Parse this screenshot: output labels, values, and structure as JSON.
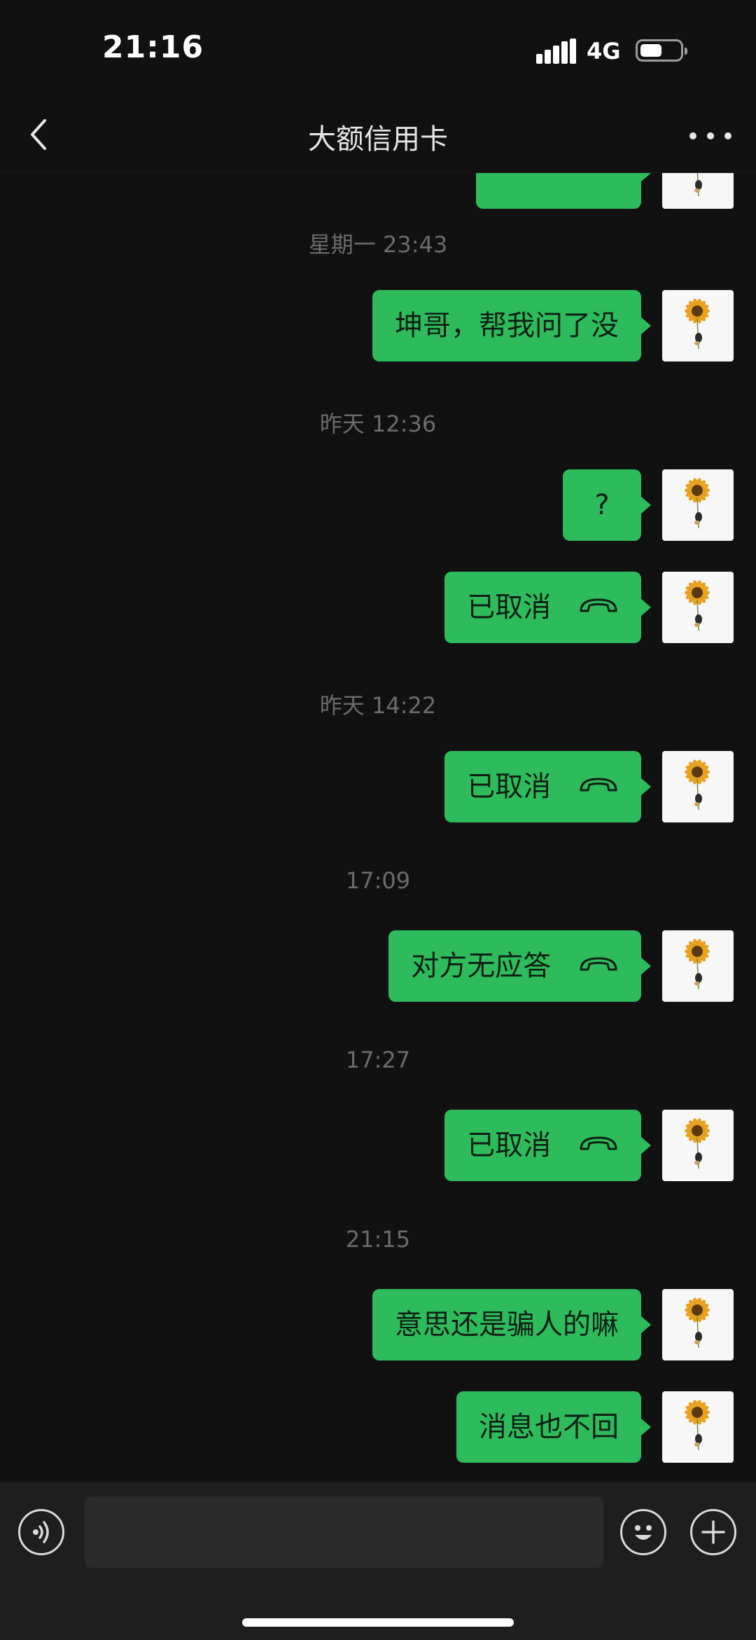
{
  "status_bar": {
    "time": "21:16",
    "network": "4G"
  },
  "nav": {
    "title": "大额信用卡"
  },
  "messages": [
    {
      "type": "timestamp",
      "text": "星期一 23:43"
    },
    {
      "type": "text",
      "text": "坤哥，帮我问了没"
    },
    {
      "type": "timestamp",
      "text": "昨天 12:36"
    },
    {
      "type": "text",
      "text": "?"
    },
    {
      "type": "call",
      "text": "已取消",
      "icon": "phone-hangup-icon"
    },
    {
      "type": "timestamp",
      "text": "昨天 14:22"
    },
    {
      "type": "call",
      "text": "已取消",
      "icon": "phone-hangup-icon"
    },
    {
      "type": "timestamp",
      "text": "17:09"
    },
    {
      "type": "call",
      "text": "对方无应答",
      "icon": "phone-hangup-icon"
    },
    {
      "type": "timestamp",
      "text": "17:27"
    },
    {
      "type": "call",
      "text": "已取消",
      "icon": "phone-hangup-icon"
    },
    {
      "type": "timestamp",
      "text": "21:15"
    },
    {
      "type": "text",
      "text": "意思还是骗人的嘛"
    },
    {
      "type": "text",
      "text": "消息也不回"
    }
  ],
  "colors": {
    "background": "#111111",
    "bubble": "#2ebb5c",
    "timestamp": "#6b6b6b"
  },
  "input_bar": {
    "icons": [
      "voice-icon",
      "emoji-icon",
      "plus-icon"
    ]
  }
}
